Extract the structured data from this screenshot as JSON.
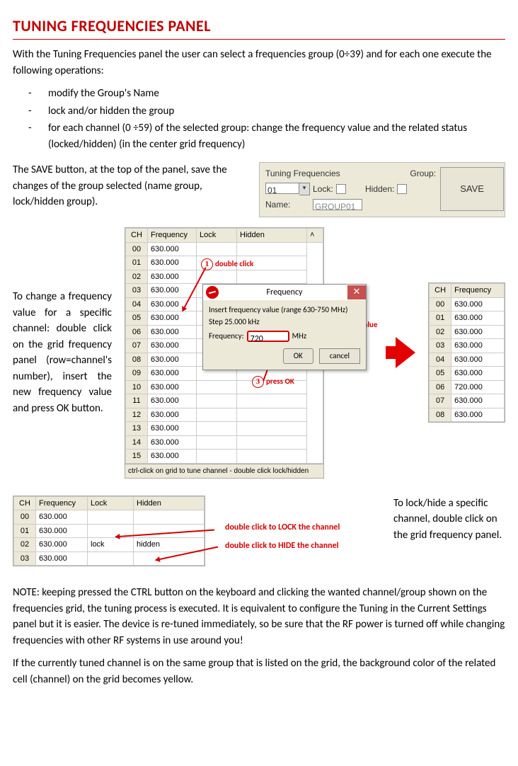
{
  "heading": "TUNING FREQUENCIES PANEL",
  "intro": "With the Tuning Frequencies panel the user can select a frequencies group (0÷39) and for each one execute the following operations:",
  "bullets": [
    "modify the Group's Name",
    "lock and/or hidden the group",
    "for each channel (0 ÷59) of the selected group: change the frequency value and the related status (locked/hidden) (in the center grid frequency)"
  ],
  "save_text": "The SAVE button, at the top of the panel, save the changes of the group selected (name group, lock/hidden group).",
  "top_panel": {
    "title": "Tuning Frequencies",
    "group_label": "Group:",
    "group_value": "01",
    "lock_label": "Lock:",
    "hidden_label": "Hidden:",
    "name_label": "Name:",
    "name_value": "GROUP01",
    "save_btn": "SAVE"
  },
  "change_text": "To change a frequency value for a specific channel: double click on the grid frequency panel (row=channel's number), insert the new frequency value and press OK button.",
  "grid_main": {
    "headers": [
      "CH",
      "Frequency",
      "Lock",
      "Hidden"
    ],
    "rows": [
      [
        "00",
        "630.000",
        "",
        ""
      ],
      [
        "01",
        "630.000",
        "",
        ""
      ],
      [
        "02",
        "630.000",
        "",
        ""
      ],
      [
        "03",
        "630.000",
        "",
        ""
      ],
      [
        "04",
        "630.000",
        "",
        ""
      ],
      [
        "05",
        "630.000",
        "",
        ""
      ],
      [
        "06",
        "630.000",
        "",
        ""
      ],
      [
        "07",
        "630.000",
        "",
        ""
      ],
      [
        "08",
        "630.000",
        "",
        ""
      ],
      [
        "09",
        "630.000",
        "",
        ""
      ],
      [
        "10",
        "630.000",
        "",
        ""
      ],
      [
        "11",
        "630.000",
        "",
        ""
      ],
      [
        "12",
        "630.000",
        "",
        ""
      ],
      [
        "13",
        "630.000",
        "",
        ""
      ],
      [
        "14",
        "630.000",
        "",
        ""
      ],
      [
        "15",
        "630.000",
        "",
        ""
      ]
    ],
    "status": "ctrl-click on grid to tune channel - double click lock/hidden"
  },
  "dialog": {
    "title": "Frequency",
    "line1": "Insert frequency value (range 630-750 MHz)",
    "line2": "Step 25.000 kHz",
    "freq_label": "Frequency:",
    "freq_value": "720",
    "unit": "MHz",
    "ok": "OK",
    "cancel": "cancel"
  },
  "annotations": {
    "a1": "double click",
    "a2": "insert freq. value",
    "a3": "press OK"
  },
  "grid_right": {
    "headers": [
      "CH",
      "Frequency"
    ],
    "rows": [
      [
        "00",
        "630.000"
      ],
      [
        "01",
        "630.000"
      ],
      [
        "02",
        "630.000"
      ],
      [
        "03",
        "630.000"
      ],
      [
        "04",
        "630.000"
      ],
      [
        "05",
        "630.000"
      ],
      [
        "06",
        "720.000"
      ],
      [
        "07",
        "630.000"
      ],
      [
        "08",
        "630.000"
      ]
    ]
  },
  "lockhide_text": "To lock/hide a specific channel, double click on the grid frequency panel.",
  "grid_lockhide": {
    "headers": [
      "CH",
      "Frequency",
      "Lock",
      "Hidden"
    ],
    "rows": [
      [
        "00",
        "630.000",
        "",
        ""
      ],
      [
        "01",
        "630.000",
        "",
        ""
      ],
      [
        "02",
        "630.000",
        "lock",
        "hidden"
      ],
      [
        "03",
        "630.000",
        "",
        ""
      ]
    ]
  },
  "lockhide_ann1": "double click to LOCK the channel",
  "lockhide_ann2": "double click to HIDE the channel",
  "note": "NOTE: keeping pressed the CTRL button on the keyboard and clicking the wanted channel/group shown on the frequencies grid, the tuning process is executed. It is equivalent to configure the Tuning in the Current Settings panel but it is easier.  The device is re-tuned immediately, so be sure that the RF power is turned off while changing frequencies with other RF systems in use around you!",
  "final": "If the currently tuned channel is on the same group that is listed on the grid, the background color of the related cell (channel) on the grid becomes yellow."
}
